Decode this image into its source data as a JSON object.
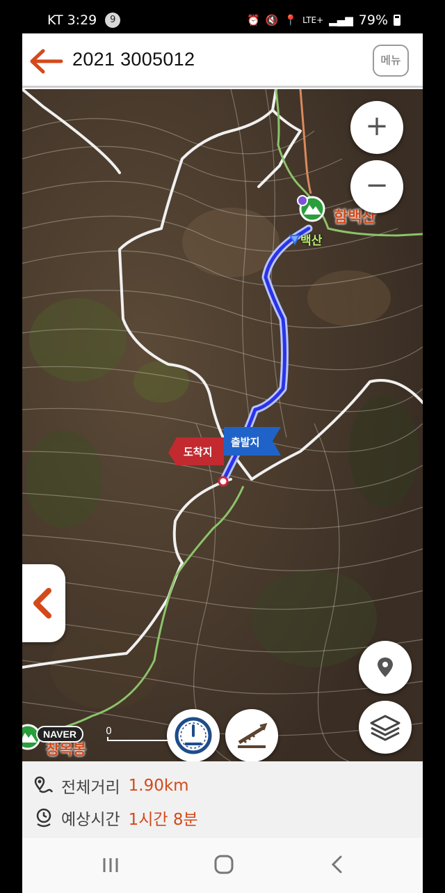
{
  "status": {
    "carrier": "KT",
    "time": "3:29",
    "badge": "9",
    "network": "LTE+",
    "battery": "79%"
  },
  "header": {
    "title": "2021 3005012",
    "menu_label": "메뉴"
  },
  "map": {
    "peak_label": "함백산",
    "peak_label_partial": "백산",
    "start_flag": "출발지",
    "end_flag": "도착지",
    "corner_label": "창옥봉",
    "naver": "NAVER",
    "scale": "0"
  },
  "controls": {
    "zoom_in": "+",
    "zoom_out": "−"
  },
  "summary": {
    "distance_label": "전체거리",
    "distance_value": "1.90km",
    "time_label": "예상시간",
    "time_value": "1시간 8분"
  },
  "colors": {
    "accent": "#d4491a",
    "route": "#2b33e8",
    "trail_green": "#8cc46b",
    "trail_orange": "#d98a5e"
  }
}
